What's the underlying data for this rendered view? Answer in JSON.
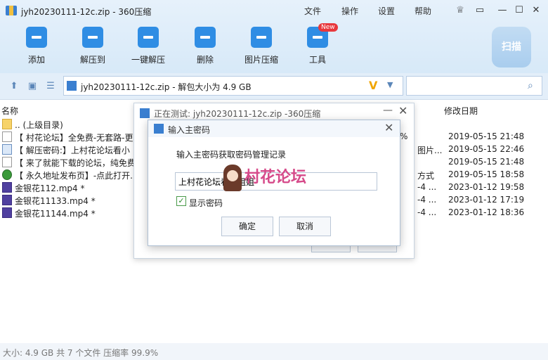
{
  "window": {
    "title": "jyh20230111-12c.zip - 360压缩",
    "menu": [
      "文件",
      "操作",
      "设置",
      "帮助"
    ]
  },
  "toolbar": {
    "buttons": [
      {
        "label": "添加",
        "icon": "add-icon"
      },
      {
        "label": "解压到",
        "icon": "extract-to-icon"
      },
      {
        "label": "一键解压",
        "icon": "one-click-extract-icon"
      },
      {
        "label": "删除",
        "icon": "delete-icon"
      },
      {
        "label": "图片压缩",
        "icon": "image-compress-icon"
      },
      {
        "label": "工具",
        "icon": "tools-icon"
      }
    ],
    "new_badge": "New",
    "scan_label": "扫描"
  },
  "address": {
    "text": "jyh20230111-12c.zip - 解包大小为 4.9 GB",
    "search_placeholder": ""
  },
  "list": {
    "col_name": "名称",
    "col_date": "修改日期",
    "rows": [
      {
        "name": ".. (上级目录)",
        "type": "folder",
        "extra": "",
        "date": ""
      },
      {
        "name": "【 村花论坛】全免费-无套路-更",
        "type": "doc",
        "extra": "%",
        "date": "2019-05-15 21:48"
      },
      {
        "name": "【 解压密码:】上村花论坛看小",
        "type": "jpg",
        "extra": "图片...",
        "date": "2019-05-15 22:46"
      },
      {
        "name": "【 来了就能下载的论坛，纯免费",
        "type": "doc",
        "extra": "",
        "date": "2019-05-15 21:48"
      },
      {
        "name": "【 永久地址发布页】-点此打开.",
        "type": "globe",
        "extra": "方式",
        "date": "2019-05-15 18:58"
      },
      {
        "name": "金银花112.mp4 *",
        "type": "mp4",
        "extra": "-4 ...",
        "date": "2023-01-12 19:58"
      },
      {
        "name": "金银花11133.mp4 *",
        "type": "mp4",
        "extra": "-4 ...",
        "date": "2023-01-12 17:19"
      },
      {
        "name": "金银花11144.mp4 *",
        "type": "mp4",
        "extra": "-4 ...",
        "date": "2023-01-12 18:36"
      }
    ]
  },
  "status": {
    "text": "大小: 4.9 GB 共 7 个文件 压缩率 99.9%"
  },
  "test_dialog": {
    "title": "正在测试: jyh20230111-12c.zip -360压缩",
    "percent": "%"
  },
  "password_dialog": {
    "title": "输入主密码",
    "prompt": "输入主密码获取密码管理记录",
    "value": "上村花论坛看小姐姐",
    "show_password_label": "显示密码",
    "ok_label": "确定",
    "cancel_label": "取消"
  },
  "watermark": {
    "text": "村花论坛"
  },
  "colors": {
    "accent": "#2f8de4",
    "title_bg": "#e6f1fb",
    "new_badge": "#e8383d"
  }
}
